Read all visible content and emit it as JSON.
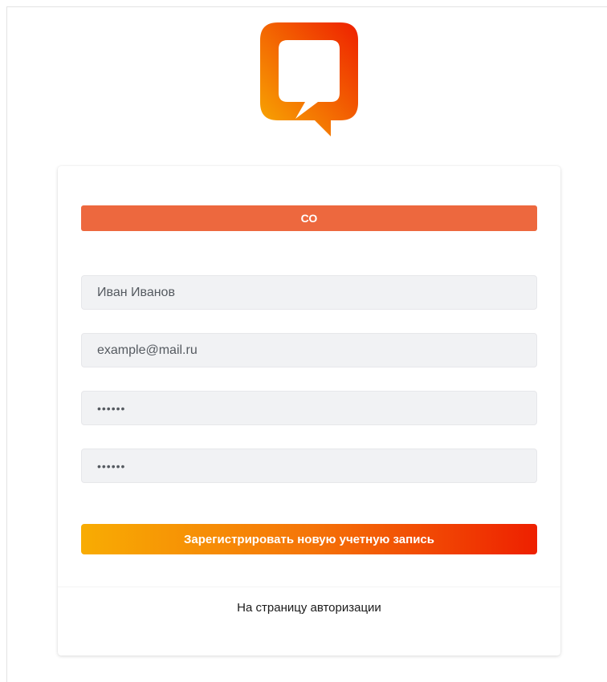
{
  "brand": {
    "logo_icon": "chat-bubble-logo",
    "gradient_start": "#f8ac03",
    "gradient_end": "#ee2000"
  },
  "form": {
    "badge_text": "СО",
    "badge_color": "#ed683e",
    "name_value": "Иван Иванов",
    "email_value": "example@mail.ru",
    "password_value": "••••••",
    "password_confirm_value": "••••••",
    "submit_label": "Зарегистрировать новую учетную запись"
  },
  "footer": {
    "login_link": "На страницу авторизации"
  }
}
